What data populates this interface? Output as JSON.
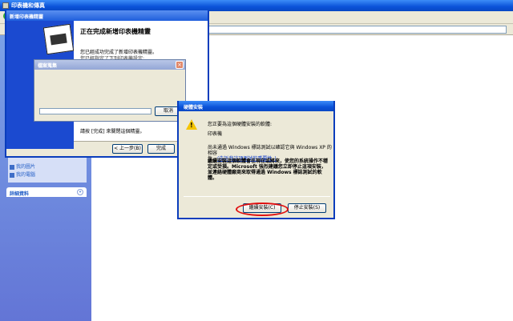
{
  "main_window": {
    "title": "印表機和傳真"
  },
  "side_pane": {
    "links": [
      "我的圖片",
      "我的電腦"
    ],
    "details_header": "詳細資料",
    "chevron": "»"
  },
  "wizard": {
    "title": "新增印表機精靈",
    "heading": "正在完成新增印表機精靈",
    "paragraph1": "您已經成功完成了新增印表機精靈。",
    "paragraph2": "您已經指定了下列印表機設定:",
    "finish_text": "請按 [完成] 來關閉這個精靈。",
    "back_label": "< 上一步(B)",
    "finish_label": "完成"
  },
  "copy_dialog": {
    "title": "檔案蒐集",
    "cancel_label": "取消",
    "progress_percent": 0
  },
  "hardware_dialog": {
    "title": "硬體安裝",
    "line1": "您正要為這個硬體安裝的軟體:",
    "device": "印表機",
    "line3a": "尚未通過 Windows 標誌測試以確認它與 Windows XP 的相容",
    "line3b": "性。",
    "link": "(告訴我這項測試的重要性。)",
    "warning": "繼續安裝這個軟體會在現在或將來，使您的系統操作不穩定或受損。Microsoft 強烈建議您立即停止這項安裝，並連絡硬體廠商來取得通過 Windows 標誌測試的軟體。",
    "continue_label": "繼續安裝(C)",
    "stop_label": "停止安裝(S)"
  }
}
